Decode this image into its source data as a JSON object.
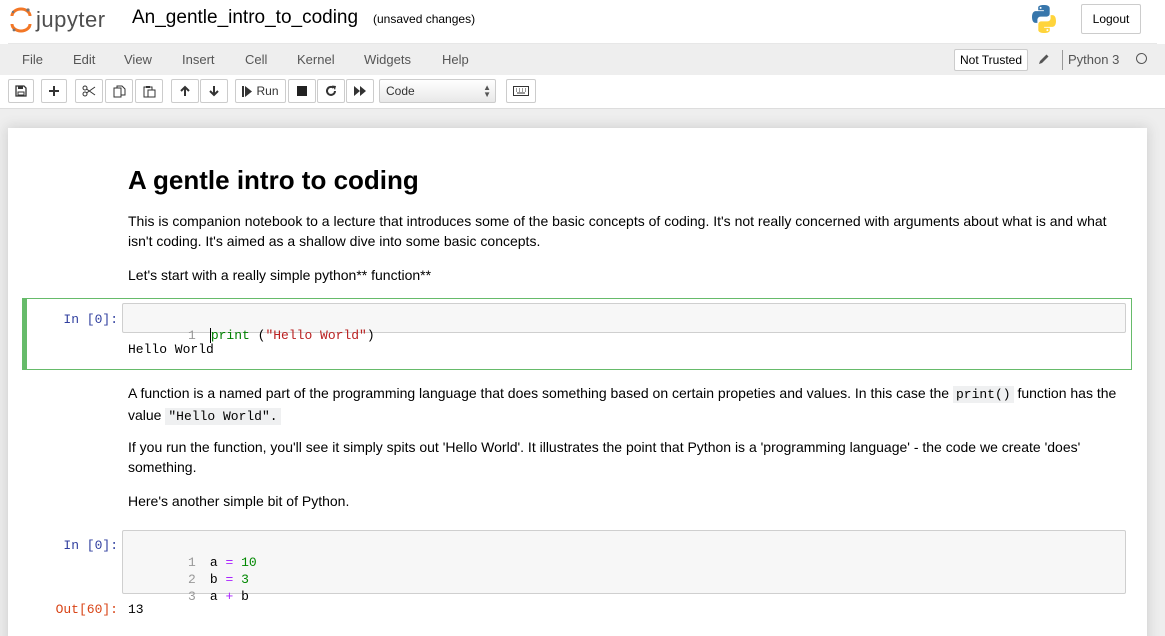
{
  "header": {
    "logo_text": "jupyter",
    "notebook_name": "An_gentle_intro_to_coding",
    "save_status": "(unsaved changes)",
    "logout_label": "Logout"
  },
  "menubar": {
    "items": [
      "File",
      "Edit",
      "View",
      "Insert",
      "Cell",
      "Kernel",
      "Widgets",
      "Help"
    ],
    "not_trusted": "Not Trusted",
    "kernel_name": "Python 3"
  },
  "toolbar": {
    "run_label": "Run",
    "cell_type": "Code"
  },
  "notebook": {
    "title": "A gentle intro to coding",
    "intro": "This is companion notebook to a lecture that introduces some of the basic concepts of coding. It's not really concerned with arguments about what is and what isn't coding. It's aimed as a shallow dive into some basic concepts.",
    "lets_start": "Let's start with a really simple python** function**",
    "cell1": {
      "prompt": "In [0]:",
      "line_number": "1",
      "code_kw": "print",
      "code_mid": " (",
      "code_str": "\"Hello World\"",
      "code_end": ")",
      "output": "Hello World"
    },
    "function_text_a": "A function is a named part of the programming language that does something based on certain propeties and values. In this case the",
    "function_code": "print()",
    "function_text_b": "function has the value",
    "function_value": "\"Hello World\".",
    "run_text": "If you run the function, you'll see it simply spits out 'Hello World'. It illustrates the point that Python is a 'programming language' - the code we create 'does' something.",
    "another_text": "Here's another simple bit of Python.",
    "cell2": {
      "prompt": "In [0]:",
      "lines": [
        {
          "n": "1",
          "a": "a",
          "op": "=",
          "b": "10"
        },
        {
          "n": "2",
          "a": "b",
          "op": "=",
          "b": "3"
        },
        {
          "n": "3",
          "a": "a",
          "op": "+",
          "b": "b"
        }
      ],
      "out_prompt": "Out[60]:",
      "output": "13"
    }
  },
  "colors": {
    "selected_cell": "#66bb6a",
    "in_prompt": "#303f9f",
    "out_prompt": "#d84315",
    "jupyter_orange": "#f37726"
  },
  "icons": [
    "jupyter-logo-icon",
    "python-logo-icon",
    "save-icon",
    "plus-icon",
    "cut-icon",
    "copy-icon",
    "paste-icon",
    "arrow-up-icon",
    "arrow-down-icon",
    "step-forward-icon",
    "stop-icon",
    "restart-icon",
    "fast-forward-icon",
    "keyboard-icon",
    "pencil-icon",
    "kernel-idle-icon"
  ]
}
